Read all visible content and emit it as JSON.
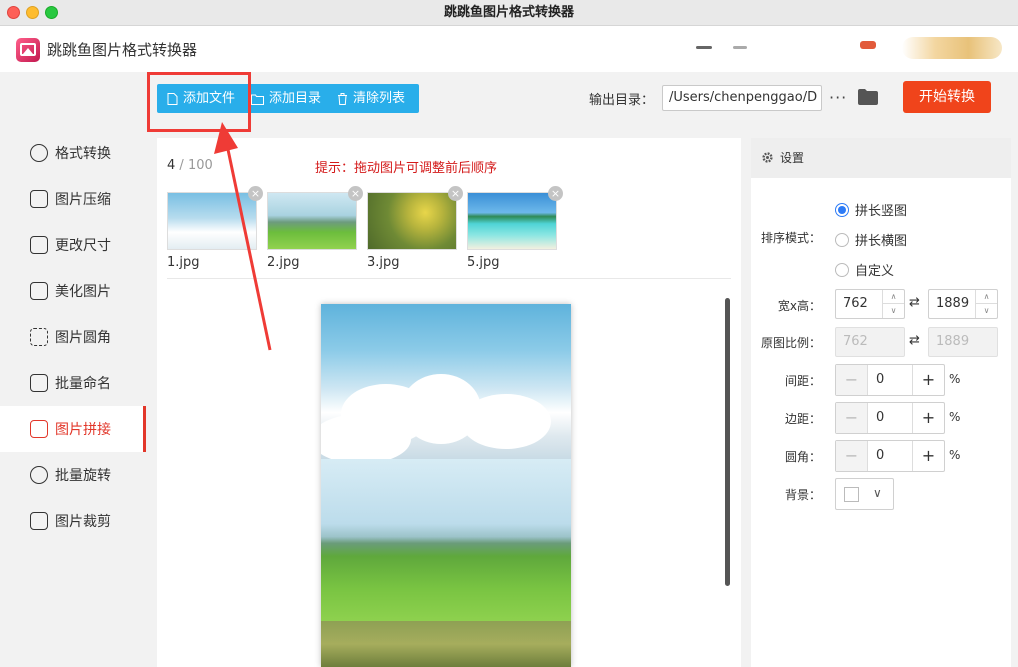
{
  "window": {
    "title": "跳跳鱼图片格式转换器"
  },
  "app": {
    "name": "跳跳鱼图片格式转换器"
  },
  "toolbar": {
    "add_file": "添加文件",
    "add_dir": "添加目录",
    "clear_list": "清除列表",
    "output_label": "输出目录：",
    "output_path": "/Users/chenpenggao/D",
    "more": "···",
    "start": "开始转换"
  },
  "sidebar": {
    "items": [
      {
        "label": "格式转换",
        "icon": "format-convert-icon"
      },
      {
        "label": "图片压缩",
        "icon": "compress-icon"
      },
      {
        "label": "更改尺寸",
        "icon": "resize-icon"
      },
      {
        "label": "美化图片",
        "icon": "beautify-icon"
      },
      {
        "label": "图片圆角",
        "icon": "round-corner-icon"
      },
      {
        "label": "批量命名",
        "icon": "rename-icon"
      },
      {
        "label": "图片拼接",
        "icon": "stitch-icon",
        "active": true
      },
      {
        "label": "批量旋转",
        "icon": "rotate-icon"
      },
      {
        "label": "图片裁剪",
        "icon": "crop-icon"
      }
    ]
  },
  "files": {
    "count": "4",
    "separator": " / ",
    "max": "100",
    "hint": "提示：拖动图片可调整前后顺序",
    "items": [
      {
        "name": "1.jpg"
      },
      {
        "name": "2.jpg"
      },
      {
        "name": "3.jpg"
      },
      {
        "name": "5.jpg"
      }
    ]
  },
  "settings": {
    "header": "设置",
    "sort_mode_label": "排序模式：",
    "sort_modes": [
      "拼长竖图",
      "拼长横图",
      "自定义"
    ],
    "size_label": "宽x高：",
    "width": "762",
    "height": "1889",
    "ratio_label": "原图比例：",
    "ratio_width": "762",
    "ratio_height": "1889",
    "spacing_label": "间距：",
    "spacing": "0",
    "margin_label": "边距：",
    "margin": "0",
    "corner_label": "圆角：",
    "corner": "0",
    "percent": "%",
    "background_label": "背景："
  },
  "colors": {
    "accent_blue": "#29aeea",
    "start_button": "#f0441b",
    "active_nav": "#e2372a",
    "hint_red": "#d41a1a",
    "annotation_red": "#ef3b36"
  }
}
